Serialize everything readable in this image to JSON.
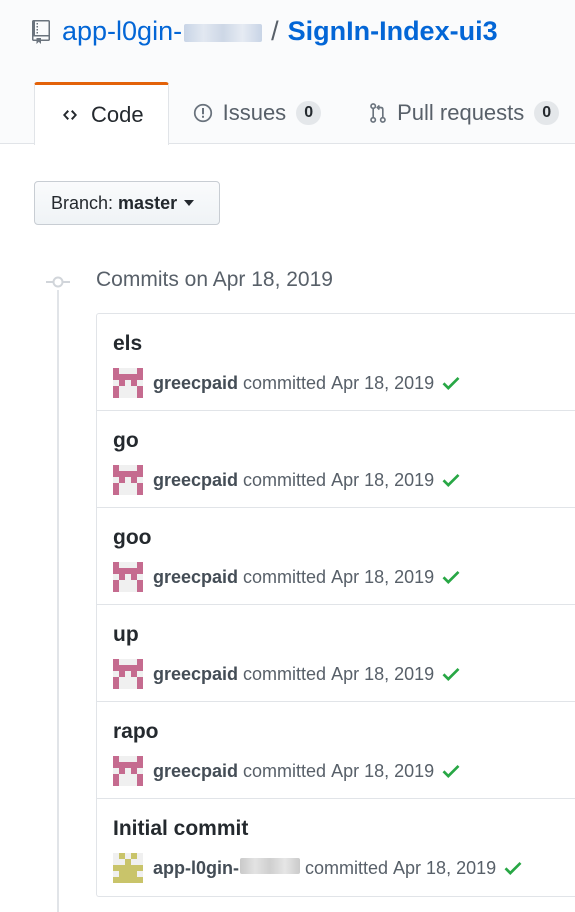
{
  "repo": {
    "owner": "app-l0gin-",
    "separator": "/",
    "name": "SignIn-Index-ui3"
  },
  "tabs": [
    {
      "label": "Code",
      "selected": true
    },
    {
      "label": "Issues",
      "count": "0"
    },
    {
      "label": "Pull requests",
      "count": "0"
    }
  ],
  "branch": {
    "prefix": "Branch:",
    "name": "master"
  },
  "group_title": "Commits on Apr 18, 2019",
  "commits": [
    {
      "message": "els",
      "author": "greecpaid",
      "action": "committed",
      "date": "Apr 18, 2019"
    },
    {
      "message": "go",
      "author": "greecpaid",
      "action": "committed",
      "date": "Apr 18, 2019"
    },
    {
      "message": "goo",
      "author": "greecpaid",
      "action": "committed",
      "date": "Apr 18, 2019"
    },
    {
      "message": "up",
      "author": "greecpaid",
      "action": "committed",
      "date": "Apr 18, 2019"
    },
    {
      "message": "rapo",
      "author": "greecpaid",
      "action": "committed",
      "date": "Apr 18, 2019"
    },
    {
      "message": "Initial commit",
      "author": "app-l0gin-",
      "action": "committed",
      "date": "Apr 18, 2019"
    }
  ],
  "colors": {
    "link": "#0366d6",
    "tab_accent": "#e36209",
    "success": "#28a745",
    "avatar_pink": "#c56b8f",
    "avatar_olive": "#c9c46a"
  },
  "icons": {
    "repo": "repo-icon",
    "code": "code-icon",
    "issues": "issue-opened-icon",
    "pulls": "git-pull-request-icon",
    "caret": "triangle-down-icon",
    "commit_node": "git-commit-icon",
    "status": "check-icon"
  }
}
